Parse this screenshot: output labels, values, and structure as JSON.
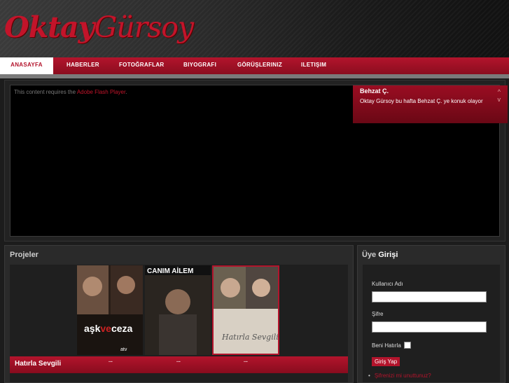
{
  "site": {
    "logo_part1": "Oktay",
    "logo_part2": "Gürsoy"
  },
  "nav": {
    "items": [
      {
        "label": "ANASAYFA",
        "active": true
      },
      {
        "label": "HABERLER"
      },
      {
        "label": "FOTOĞRAFLAR"
      },
      {
        "label": "BIYOGRAFI"
      },
      {
        "label": "GÖRÜŞLERINIZ"
      },
      {
        "label": "ILETIŞIM"
      }
    ]
  },
  "flash": {
    "message_prefix": "This content requires the ",
    "link_text": "Adobe Flash Player",
    "message_suffix": "."
  },
  "news": {
    "title": "Behzat Ç.",
    "text": "Oktay Gürsoy bu hafta Behzat Ç. ye konuk olayor",
    "up_arrow": "^",
    "down_arrow": "v"
  },
  "projects": {
    "section_title": "Projeler",
    "selected_title": "Hatırla Sevgili",
    "dot_label": "...",
    "posters": [
      {
        "title_text": "aşk ve ceza",
        "channel": "atv",
        "colors": [
          "#3a2a20",
          "#7a5a40"
        ]
      },
      {
        "title_text": "CANIM AİLEM",
        "colors": [
          "#2a2a2a",
          "#5a4a3a"
        ]
      },
      {
        "title_text": "Hatırla Sevgili",
        "colors": [
          "#8a8070",
          "#d8d0c0"
        ]
      }
    ]
  },
  "login": {
    "section_title_1": "Üye ",
    "section_title_2": "Girişi",
    "username_label": "Kullanıcı Adı",
    "password_label": "Şifre",
    "remember_label": "Beni Hatırla",
    "submit_label": "Giriş Yap",
    "forgot_label": "Şifrenizi mi unuttunuz?"
  },
  "colors": {
    "accent": "#b3142c",
    "background": "#1c1c1c"
  }
}
